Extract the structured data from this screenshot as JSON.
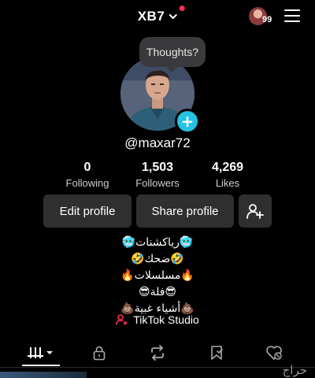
{
  "colors": {
    "background": "#000000",
    "accent_cyan": "#25c2e3",
    "notification_red": "#fe2c55",
    "button_bg": "#2f2f2f",
    "studio_pink": "#fe2c55"
  },
  "header": {
    "username": "XB7",
    "switch_icon": "chevron-down-icon",
    "friends_count": "99",
    "menu_icon": "hamburger-menu-icon"
  },
  "note": {
    "text": "Thoughts?"
  },
  "profile": {
    "handle": "@maxar72",
    "avatar_icon": "profile-photo",
    "add_icon": "plus-icon"
  },
  "stats": [
    {
      "value": "0",
      "label": "Following"
    },
    {
      "value": "1,503",
      "label": "Followers"
    },
    {
      "value": "4,269",
      "label": "Likes"
    }
  ],
  "actions": {
    "edit_profile": "Edit profile",
    "share_profile": "Share profile",
    "add_friend_icon": "add-friend-icon"
  },
  "bio": {
    "lines": [
      "🥶رياكشنات🥶",
      "🤣ضحك🤣",
      "🔥مسلسلات🔥",
      "😎فلة😎",
      "💩أشياء غبية💩"
    ]
  },
  "studio": {
    "label": "TikTok Studio",
    "icon": "person-star-icon"
  },
  "tabs": [
    {
      "name": "videos",
      "icon": "grid-bars-icon",
      "active": true
    },
    {
      "name": "private",
      "icon": "lock-icon"
    },
    {
      "name": "reposts",
      "icon": "repost-icon"
    },
    {
      "name": "favorites",
      "icon": "bookmark-icon"
    },
    {
      "name": "liked",
      "icon": "heart-icon"
    }
  ],
  "watermark": {
    "text": "حراج"
  }
}
